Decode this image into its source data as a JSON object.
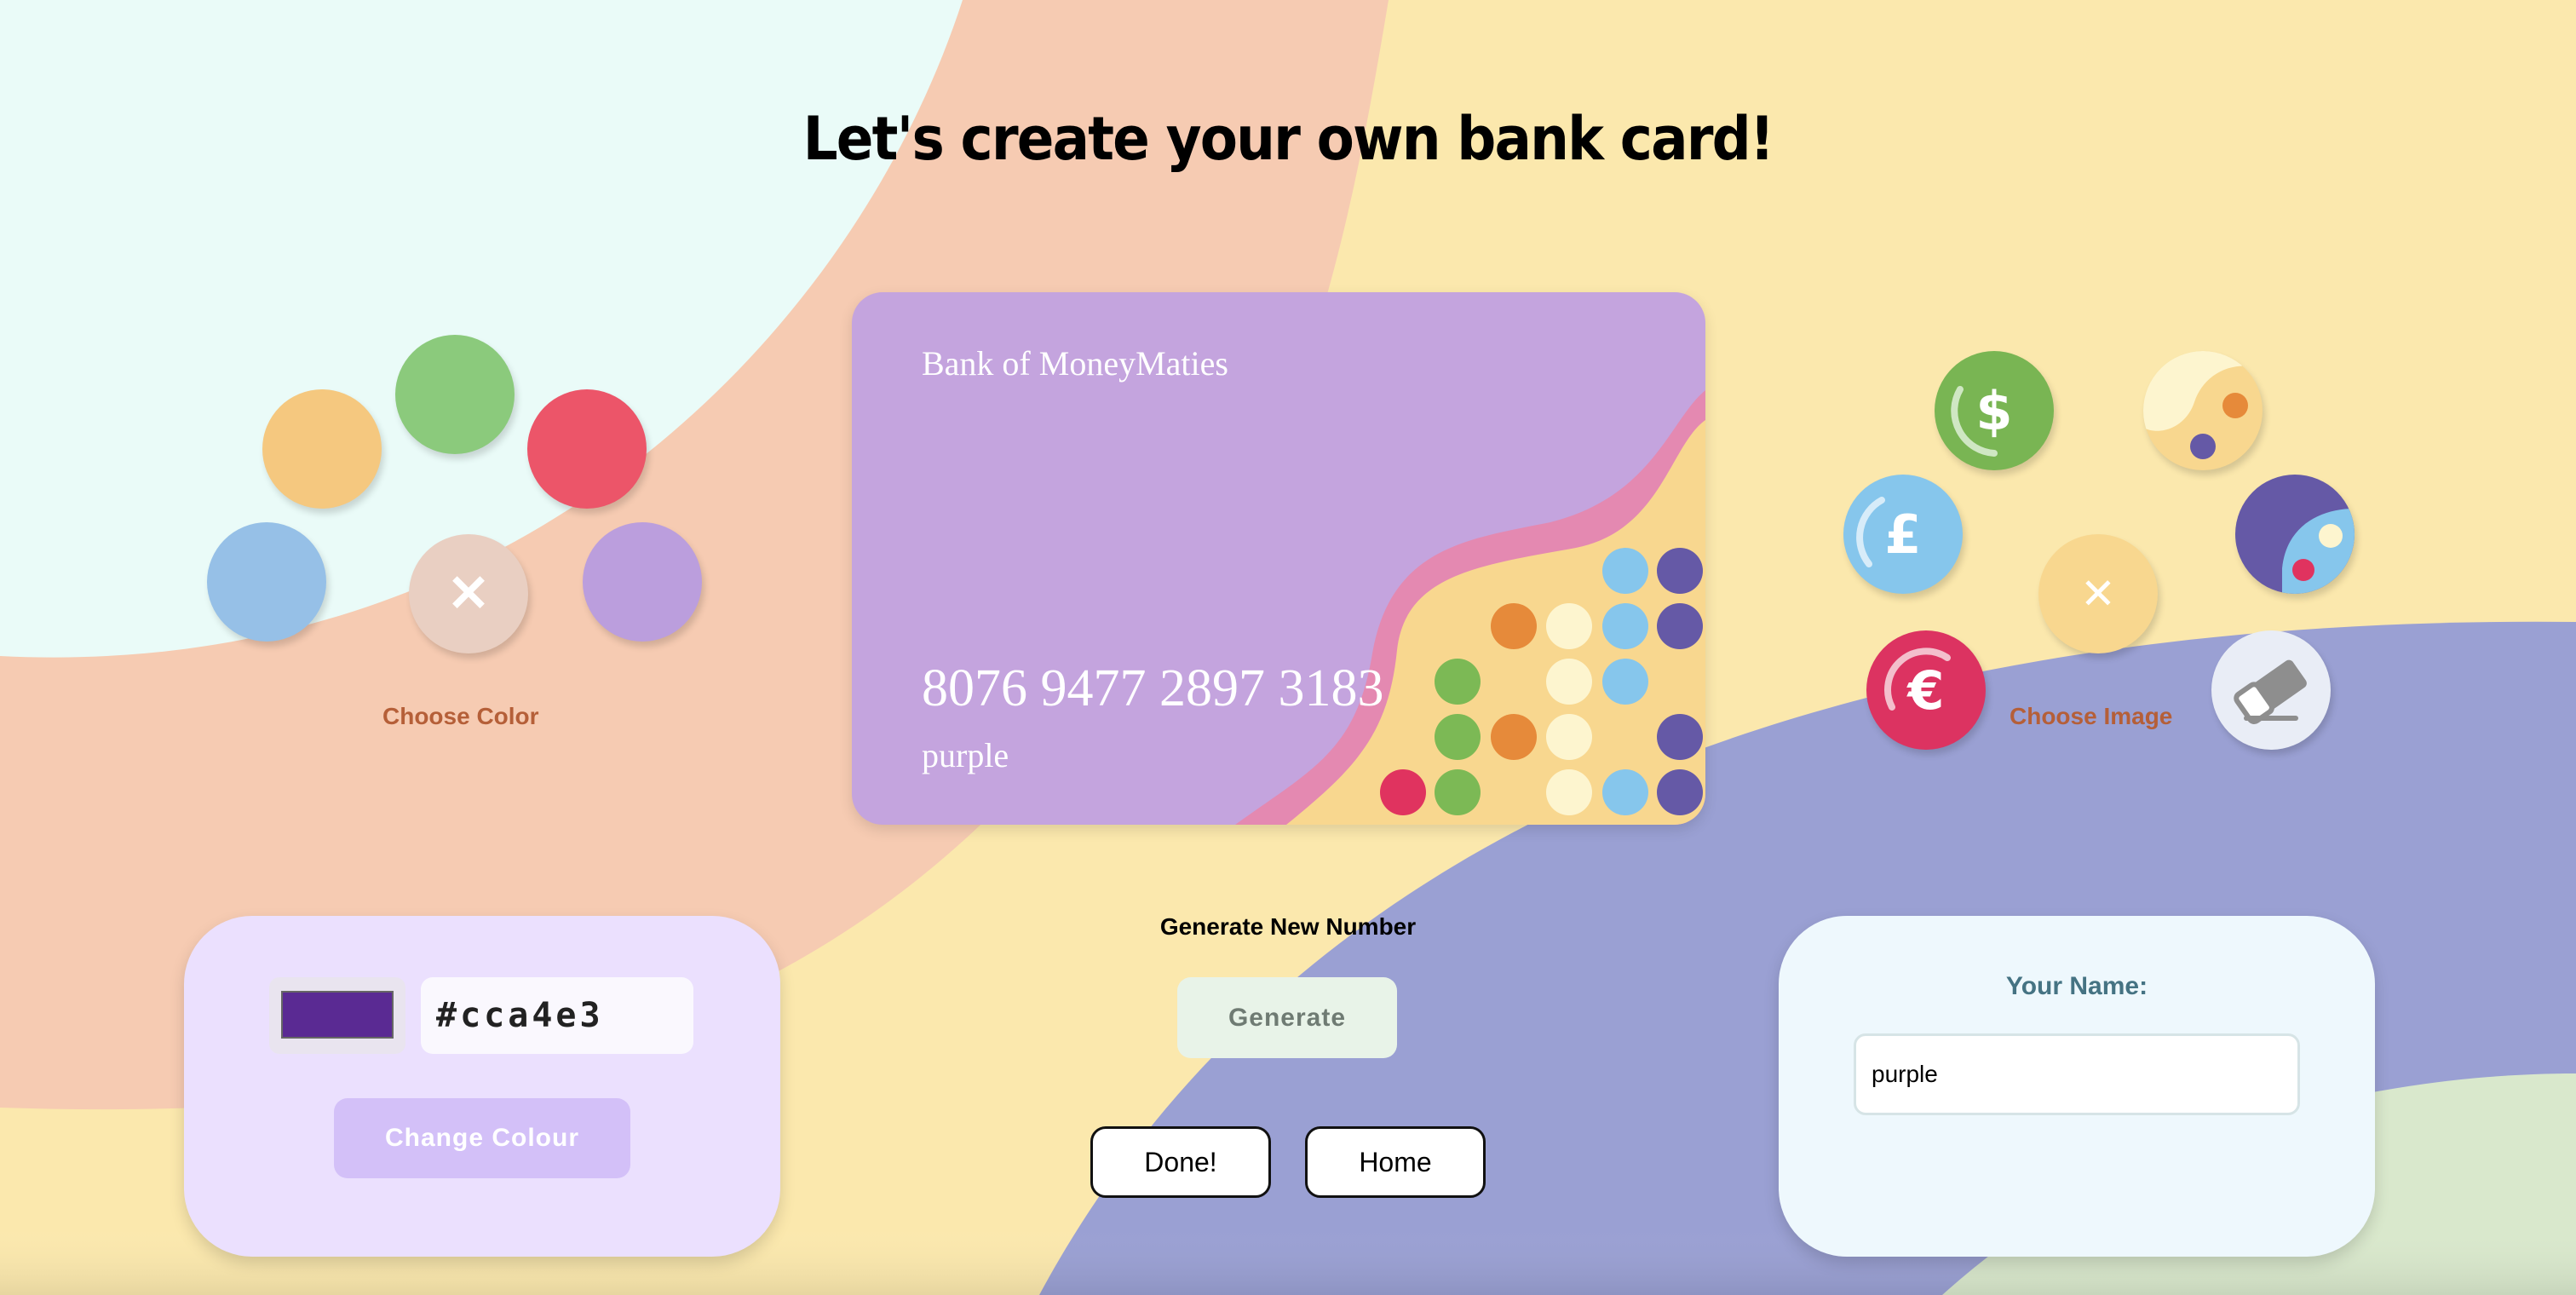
{
  "page": {
    "title": "Let's create your own bank card!"
  },
  "colors": {
    "background": "#fbe8ad",
    "peach": "#f6cbb2",
    "mint": "#eafbf8",
    "periwinkle": "#9aa0d3",
    "sage": "#d9e8cc",
    "card_base": "#c4a4de",
    "selected_swatch": "#5a2a93"
  },
  "color_picker": {
    "label": "Choose Color",
    "swatches": [
      {
        "name": "yellow",
        "color": "#f5c87f"
      },
      {
        "name": "green",
        "color": "#8bca7c"
      },
      {
        "name": "red",
        "color": "#ec5569"
      },
      {
        "name": "blue",
        "color": "#96c0e7"
      },
      {
        "name": "none",
        "color": "#e9cfc2",
        "icon": "close-icon",
        "glyph": "✕"
      },
      {
        "name": "purple",
        "color": "#bb9edd"
      }
    ]
  },
  "card": {
    "bank_name": "Bank of MoneyMaties",
    "number": "8076 9477 2897 3183",
    "holder": "purple"
  },
  "image_picker": {
    "label": "Choose Image",
    "options": [
      {
        "name": "dollar-coin",
        "glyph": "$",
        "icon": "dollar-coin-icon"
      },
      {
        "name": "dots-pattern",
        "icon": "dots-pattern-icon"
      },
      {
        "name": "pound-coin",
        "glyph": "£",
        "icon": "pound-coin-icon"
      },
      {
        "name": "none",
        "glyph": "✕",
        "icon": "close-icon"
      },
      {
        "name": "planet-pattern",
        "icon": "planet-pattern-icon"
      },
      {
        "name": "euro-coin",
        "glyph": "€",
        "icon": "euro-coin-icon"
      },
      {
        "name": "eraser",
        "icon": "eraser-icon"
      }
    ]
  },
  "colour_form": {
    "hex_value": "#cca4e3",
    "button": "Change Colour"
  },
  "generate": {
    "heading": "Generate New Number",
    "button": "Generate"
  },
  "actions": {
    "done": "Done!",
    "home": "Home"
  },
  "name_form": {
    "label": "Your Name:",
    "value": "purple"
  }
}
